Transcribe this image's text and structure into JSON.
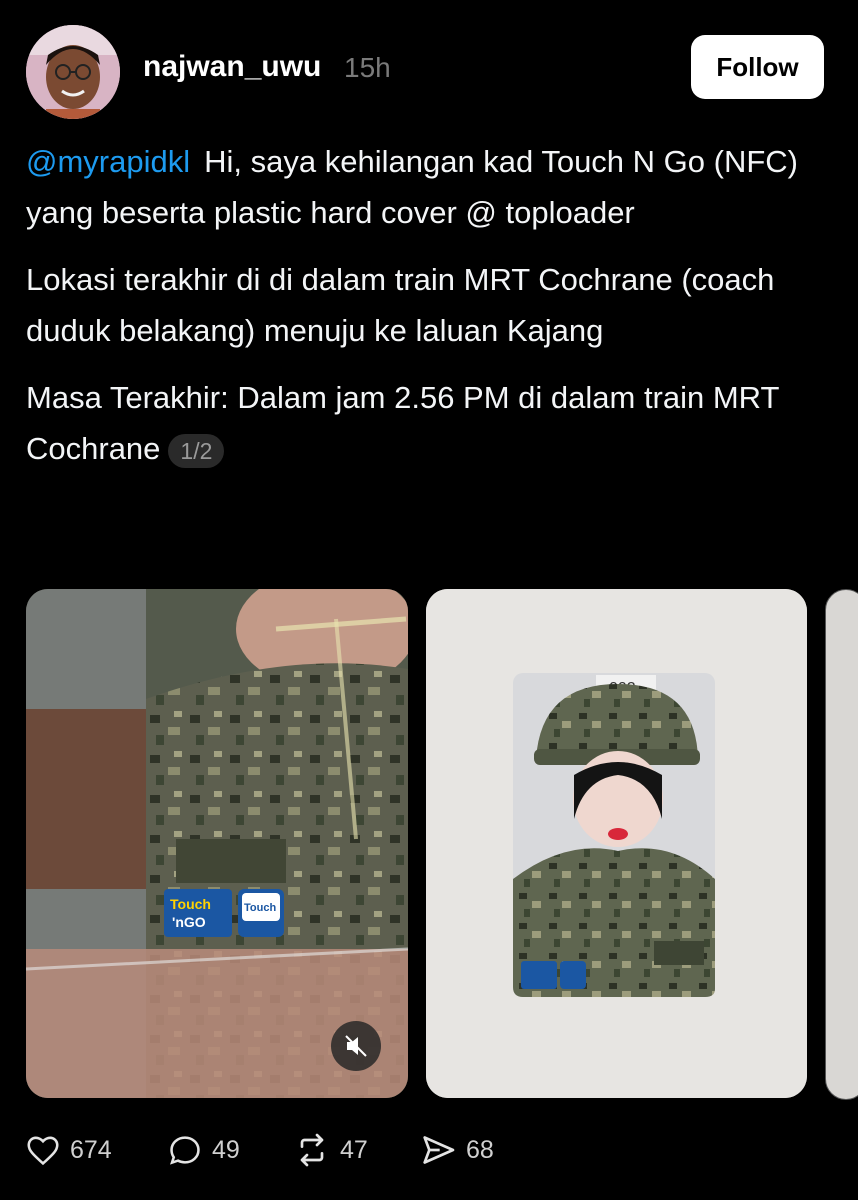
{
  "post": {
    "username": "najwan_uwu",
    "time_ago": "15h",
    "follow_label": "Follow",
    "mention": "@myrapidkl",
    "paragraphs": [
      "Hi, saya kehilangan kad Touch N Go (NFC) yang beserta plastic hard cover @ toploader",
      "Lokasi terakhir di di dalam train MRT Cochrane (coach duduk belakang) menuju ke laluan Kajang",
      "Masa Terakhir: Dalam jam 2.56 PM di dalam train MRT Cochrane"
    ],
    "media_counter": "1/2"
  },
  "media": {
    "card_number": "002",
    "logo_text_1": "Touch 'nGO",
    "logo_text_2": "Touch 'nGO eWallet"
  },
  "actions": {
    "likes": "674",
    "replies": "49",
    "reposts": "47",
    "shares": "68"
  },
  "icons": [
    "heart-icon",
    "reply-icon",
    "repost-icon",
    "share-icon",
    "mute-icon"
  ],
  "colors": {
    "background": "#000000",
    "mention": "#1d9bf0",
    "text": "#f3f5f7",
    "muted": "#7a7a7a"
  }
}
